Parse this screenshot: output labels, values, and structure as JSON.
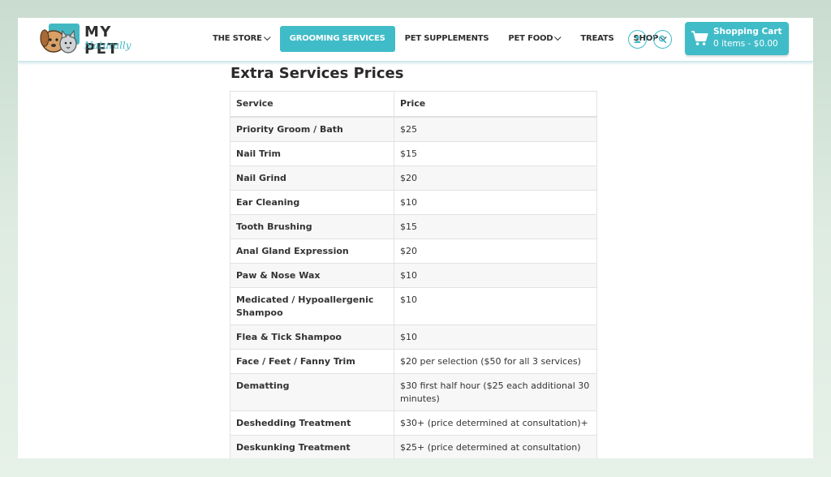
{
  "brand": {
    "name": "MY PET",
    "tagline": "Naturally"
  },
  "nav": {
    "items": [
      {
        "label": "THE STORE",
        "dropdown": true,
        "active": false
      },
      {
        "label": "GROOMING SERVICES",
        "dropdown": false,
        "active": true
      },
      {
        "label": "PET SUPPLEMENTS",
        "dropdown": false,
        "active": false
      },
      {
        "label": "PET FOOD",
        "dropdown": true,
        "active": false
      },
      {
        "label": "TREATS",
        "dropdown": false,
        "active": false
      },
      {
        "label": "SHOP",
        "dropdown": true,
        "active": false
      }
    ]
  },
  "header_icons": [
    "user-icon",
    "search-icon"
  ],
  "cart": {
    "title": "Shopping Cart",
    "summary": "0 items - $0.00"
  },
  "page": {
    "section_title": "Extra Services Prices",
    "table": {
      "headers": [
        "Service",
        "Price"
      ],
      "rows": [
        [
          "Priority Groom / Bath",
          "$25"
        ],
        [
          "Nail Trim",
          "$15"
        ],
        [
          "Nail Grind",
          "$20"
        ],
        [
          "Ear Cleaning",
          "$10"
        ],
        [
          "Tooth Brushing",
          "$15"
        ],
        [
          "Anal Gland Expression",
          "$20"
        ],
        [
          "Paw & Nose Wax",
          "$10"
        ],
        [
          "Medicated / Hypoallergenic Shampoo",
          "$10"
        ],
        [
          "Flea & Tick Shampoo",
          "$10"
        ],
        [
          "Face / Feet / Fanny Trim",
          "$20 per selection ($50 for all 3 services)"
        ],
        [
          "Dematting",
          "$30 first half hour ($25 each additional 30 minutes)"
        ],
        [
          "Deshedding Treatment",
          "$30+ (price determined at consultation)+"
        ],
        [
          "Deskunking Treatment",
          "$25+ (price determined at consultation)"
        ]
      ]
    }
  },
  "colors": {
    "accent": "#3fbcc8",
    "text": "#333333",
    "row_alt": "#f7f7f7",
    "background": "#dfece2"
  }
}
